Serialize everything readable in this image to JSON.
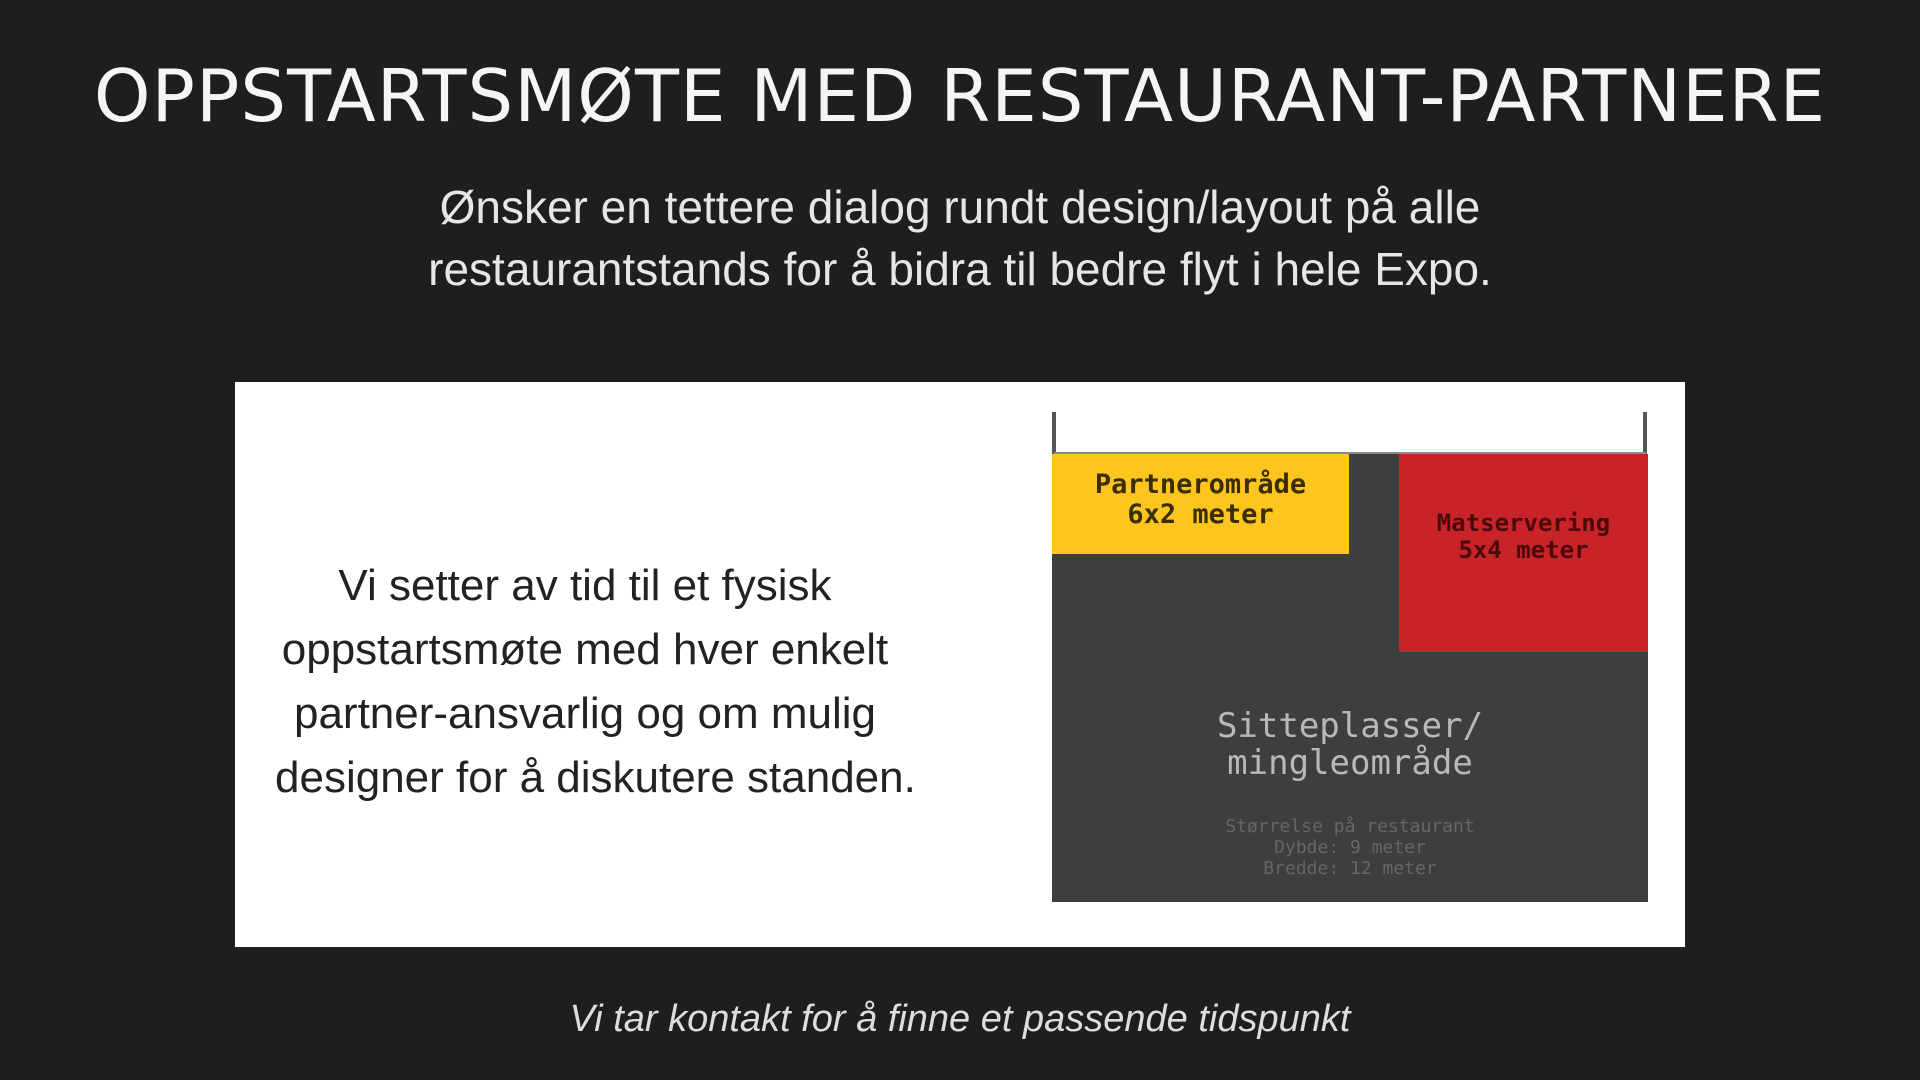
{
  "slide": {
    "title": "OPPSTARTSMØTE MED RESTAURANT-PARTNERE",
    "subtitle_lines": [
      "Ønsker en tettere dialog rundt design/layout på alle",
      "restaurantstands for å bidra til bedre flyt i hele Expo."
    ],
    "body_lines": [
      "Vi setter av tid til et fysisk",
      "oppstartsmøte med hver enkelt",
      "partner-ansvarlig og om mulig",
      "designer for å diskutere standen."
    ],
    "footer": "Vi tar kontakt for å finne et passende tidspunkt"
  },
  "diagram": {
    "partner_zone": {
      "name": "Partnerområde",
      "size": "6x2 meter",
      "color": "#fec51e"
    },
    "food_zone": {
      "name": "Matservering",
      "size": "5x4 meter",
      "color": "#c9232a"
    },
    "seating_zone": {
      "lines": [
        "Sitteplasser/",
        "mingleområde"
      ],
      "color": "#3e3e3e"
    },
    "restaurant_size": {
      "heading": "Størrelse på restaurant",
      "depth": "Dybde: 9 meter",
      "width": "Bredde: 12 meter"
    }
  },
  "colors": {
    "background": "#1e1e1e",
    "card": "#ffffff"
  }
}
